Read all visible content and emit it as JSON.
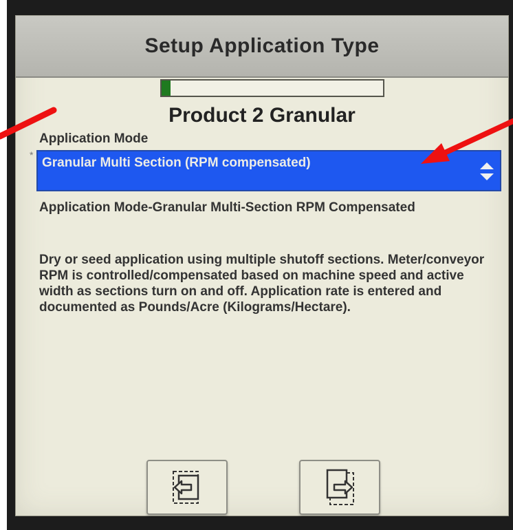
{
  "header": {
    "title": "Setup Application Type"
  },
  "progress": {
    "fraction": 0.04,
    "color": "#1f7a1f"
  },
  "product": {
    "title": "Product 2 Granular"
  },
  "field": {
    "label": "Application Mode",
    "required_marker": "*",
    "selected_value": "Granular Multi Section (RPM compensated)",
    "highlight_color": "#1e58f0"
  },
  "mode_info": {
    "name": "Application Mode-Granular Multi-Section RPM Compensated",
    "description": "Dry or seed application using multiple shutoff sections.  Meter/conveyor RPM is controlled/compensated based on machine speed and active width as sections turn on and off. Application rate is entered and documented as Pounds/Acre (Kilograms/Hectare)."
  },
  "navigation": {
    "back_icon": "page-back-icon",
    "next_icon": "page-next-icon"
  },
  "annotations": {
    "arrow_color": "#ee1111"
  }
}
